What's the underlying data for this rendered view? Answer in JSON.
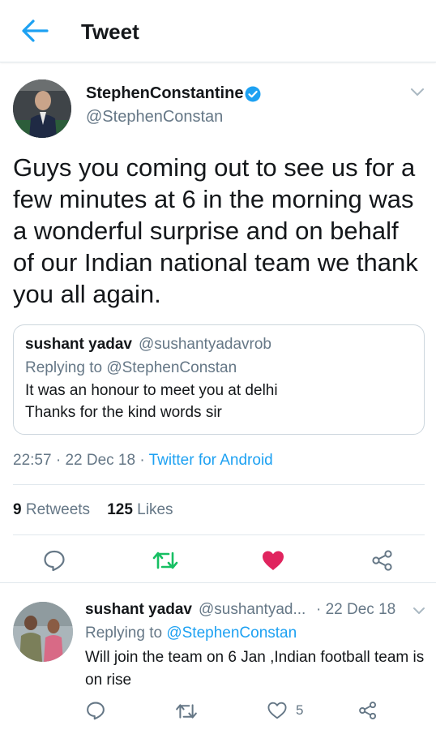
{
  "header": {
    "title": "Tweet",
    "back_icon": "back-arrow-icon"
  },
  "tweet": {
    "author_name": "StephenConstantine",
    "author_handle": "@StephenConstan",
    "verified": true,
    "text": "Guys you coming out to see us for a few minutes at 6 in the morning was a wonderful surprise and on behalf of our Indian national team we thank you all again.",
    "quote": {
      "name": "sushant yadav",
      "handle": "@sushantyadavrob",
      "replying_to": "Replying to @StephenConstan",
      "line1": "It was an honour to meet you at delhi",
      "line2": "Thanks for the kind words sir"
    },
    "time": "22:57",
    "date": "22 Dec 18",
    "source": "Twitter for Android",
    "sep": "·",
    "retweets_count": "9",
    "retweets_label": "Retweets",
    "likes_count": "125",
    "likes_label": "Likes",
    "liked": true
  },
  "reply": {
    "name": "sushant yadav",
    "handle": "@sushantyad...",
    "date": "· 22 Dec 18",
    "replying_prefix": "Replying to ",
    "replying_handle": "@StephenConstan",
    "text": "Will join the team on 6 Jan ,Indian football team is on rise",
    "likes": "5"
  },
  "colors": {
    "accent": "#1da1f2",
    "retweet_green": "#17bf63",
    "like_pink": "#e0245e",
    "secondary_text": "#657786",
    "border": "#e1e8ed"
  }
}
